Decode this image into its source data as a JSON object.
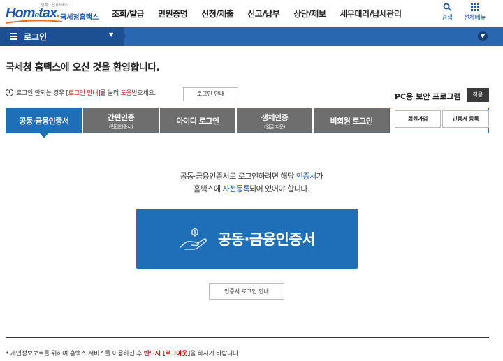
{
  "header": {
    "logo_tag": "언제나 납세서비스",
    "logo_word_a": "Hom",
    "logo_word_e": "e",
    "logo_word_b": "tax",
    "logo_dot": ".",
    "logo_sub": "국세청홈택스",
    "menu": [
      "조회/발급",
      "민원증명",
      "신청/제출",
      "신고/납부",
      "상담/제보",
      "세무대리/납세관리"
    ],
    "search_label": "검색",
    "all_menu_label": "전체메뉴"
  },
  "navbar": {
    "title": "로그인",
    "caret": "▼",
    "collapse": "▼"
  },
  "welcome": "국세청 홈택스에 오신 것을 환영합니다.",
  "notice": {
    "icon": "!",
    "pre": "로그인 안되는 경우 ",
    "link1": "[로그인 안내]",
    "mid": "를 눌러 ",
    "link2": "도움",
    "post": "받으세요.",
    "button": "로그인 안내"
  },
  "pc_security": {
    "label": "PC용 보안 프로그램",
    "apply": "적용"
  },
  "tabs": [
    {
      "label": "공동·금융인증서",
      "sub": ""
    },
    {
      "label": "간편인증",
      "sub": "(민간인증서)"
    },
    {
      "label": "아이디 로그인",
      "sub": ""
    },
    {
      "label": "생체인증",
      "sub": "(얼굴·지문)"
    },
    {
      "label": "비회원 로그인",
      "sub": ""
    }
  ],
  "side_buttons": {
    "join": "회원가입",
    "register": "인증서 등록"
  },
  "description": {
    "line1_pre": "공동·금융인증서로 로그인하려면 해당 ",
    "line1_hl": "인증서",
    "line1_post": "가",
    "line2_pre": "홈택스에 ",
    "line2_hl": "사전등록",
    "line2_post": "되어 있어야 합니다."
  },
  "cert_button": "공동·금융인증서",
  "cert_guide_button": "인증서 로그인 안내",
  "footer": {
    "pre": "* 개인정보보호를 위하여 홈택스 서비스를 이용하신 후 ",
    "hl": "반드시 [로그아웃]",
    "post": "을 하시기 바랍니다."
  },
  "colors": {
    "brand_blue": "#1f6eb8",
    "nav_blue": "#2a67b1",
    "tab_gray": "#6e6e6e",
    "highlight_red": "#c0161f"
  }
}
